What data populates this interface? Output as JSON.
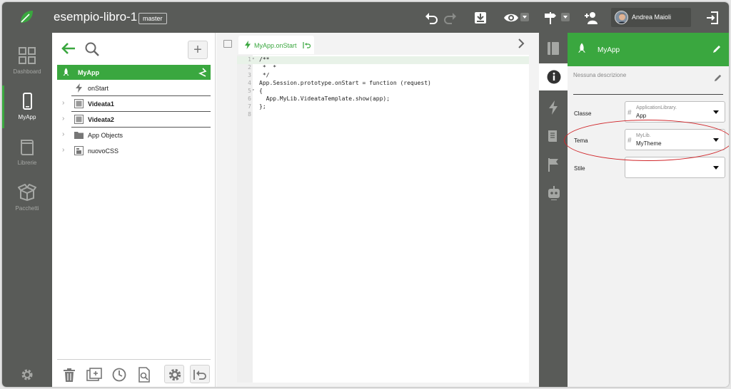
{
  "app": {
    "project_title": "esempio-libro-1",
    "branch": "master",
    "user_name": "Andrea Maioli",
    "accent_color": "#3aa73f",
    "chrome_color": "#595b58"
  },
  "toolbar": {
    "icons": [
      "undo-icon",
      "redo-icon",
      "download-icon",
      "eye-icon",
      "signpost-icon",
      "add-user-icon",
      "exit-icon"
    ]
  },
  "left_nav": {
    "items": [
      {
        "label": "Dashboard",
        "icon": "dashboard-icon",
        "active": false
      },
      {
        "label": "MyApp",
        "icon": "mobile-icon",
        "active": true
      },
      {
        "label": "Librerie",
        "icon": "library-icon",
        "active": false
      },
      {
        "label": "Pacchetti",
        "icon": "package-icon",
        "active": false
      }
    ],
    "settings_icon": "gear-icon"
  },
  "tree": {
    "selected": {
      "label": "MyApp",
      "icon": "rocket-icon"
    },
    "rows": [
      {
        "label": "onStart",
        "icon": "lightning-icon",
        "bold": false
      },
      {
        "label": "Videata1",
        "icon": "window-icon",
        "bold": true
      },
      {
        "label": "Videata2",
        "icon": "window-icon",
        "bold": true
      },
      {
        "label": "App Objects",
        "icon": "folder-icon",
        "bold": false
      },
      {
        "label": "nuovoCSS",
        "icon": "css-file-icon",
        "bold": false
      }
    ],
    "bottom_tools": [
      "trash-icon",
      "add-window-icon",
      "history-icon",
      "search-file-icon",
      "gear-icon",
      "undo-arrow-icon"
    ]
  },
  "editor": {
    "tab_label": "MyApp.onStart",
    "code_lines": [
      {
        "n": "1",
        "text": "/**"
      },
      {
        "n": "2",
        "text": " *  *"
      },
      {
        "n": "3",
        "text": " */"
      },
      {
        "n": "4",
        "text": "App.Session.prototype.onStart = function (request)"
      },
      {
        "n": "5",
        "text": "{"
      },
      {
        "n": "6",
        "text": "  App.MyLib.VideataTemplate.show(app);"
      },
      {
        "n": "7",
        "text": "};"
      },
      {
        "n": "8",
        "text": ""
      }
    ]
  },
  "props": {
    "title": "MyApp",
    "description_placeholder": "Nessuna descrizione",
    "fields": [
      {
        "label": "Classe",
        "line1": "ApplicationLibrary.",
        "line2": "App"
      },
      {
        "label": "Tema",
        "line1": "MyLib.",
        "line2": "MyTheme"
      },
      {
        "label": "Stile",
        "line1": "",
        "line2": ""
      }
    ]
  },
  "right_strip": {
    "icons": [
      "book-icon",
      "info-icon",
      "lightning-icon",
      "document-icon",
      "flag-icon",
      "robot-icon"
    ]
  }
}
